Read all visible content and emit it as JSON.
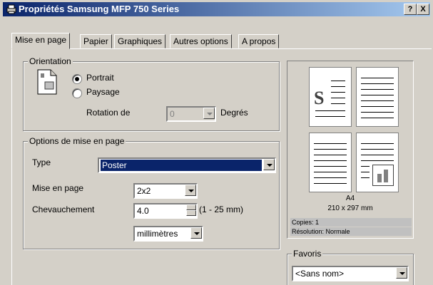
{
  "window": {
    "title": "Propriétés Samsung MFP 750 Series",
    "help_btn": "?",
    "close_btn": "X"
  },
  "tabs": [
    "Mise en page",
    "Papier",
    "Graphiques",
    "Autres options",
    "A propos"
  ],
  "orientation": {
    "label": "Orientation",
    "portrait": "Portrait",
    "landscape": "Paysage",
    "selected": "Portrait",
    "rotation_label": "Rotation de",
    "rotation_value": "0",
    "rotation_unit": "Degrés"
  },
  "layout_options": {
    "label": "Options de mise en page",
    "type_label": "Type",
    "type_value": "Poster",
    "layout_label": "Mise en page",
    "layout_value": "2x2",
    "overlap_label": "Chevauchement",
    "overlap_value": "4.0",
    "overlap_range": "(1 - 25 mm)",
    "unit_value": "millimètres"
  },
  "preview": {
    "paper": "A4",
    "size": "210 x 297 mm",
    "copies": "Copies: 1",
    "resolution": "Résolution: Normale",
    "logo_letter": "S"
  },
  "favorites": {
    "label": "Favoris",
    "value": "<Sans nom>"
  }
}
